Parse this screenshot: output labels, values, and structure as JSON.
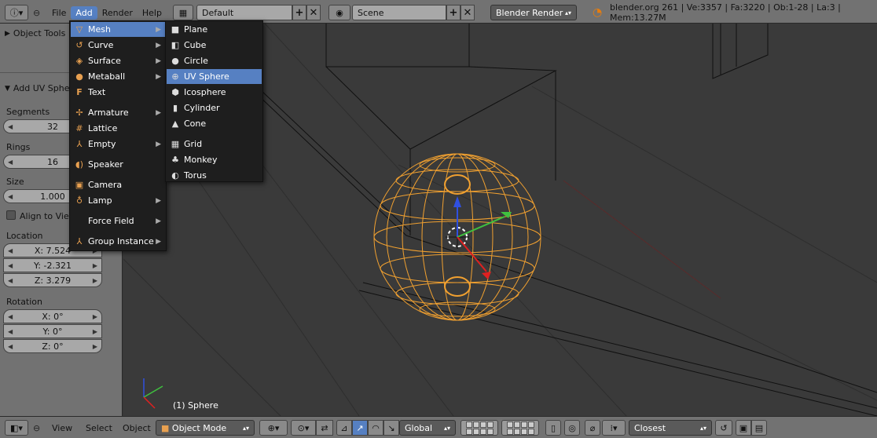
{
  "header": {
    "menus": [
      "File",
      "Add",
      "Render",
      "Help"
    ],
    "screen_layout": "Default",
    "scene": "Scene",
    "render_engine": "Blender Render",
    "stats": "blender.org 261 | Ve:3357 | Fa:3220 | Ob:1-28 | La:3 | Mem:13.27M"
  },
  "tool_panel": {
    "object_tools": "Object Tools",
    "operator_title": "Add UV Sphere",
    "segments_label": "Segments",
    "segments_value": "32",
    "rings_label": "Rings",
    "rings_value": "16",
    "size_label": "Size",
    "size_value": "1.000",
    "align_label": "Align to View",
    "location_label": "Location",
    "loc_x": "X: 7.524",
    "loc_y": "Y: -2.321",
    "loc_z": "Z: 3.279",
    "rotation_label": "Rotation",
    "rot_x": "X: 0°",
    "rot_y": "Y: 0°",
    "rot_z": "Z: 0°"
  },
  "add_menu": {
    "items": [
      "Mesh",
      "Curve",
      "Surface",
      "Metaball",
      "Text",
      "Armature",
      "Lattice",
      "Empty",
      "Speaker",
      "Camera",
      "Lamp",
      "Force Field",
      "Group Instance"
    ],
    "highlighted": "Mesh"
  },
  "mesh_submenu": {
    "items": [
      "Plane",
      "Cube",
      "Circle",
      "UV Sphere",
      "Icosphere",
      "Cylinder",
      "Cone",
      "Grid",
      "Monkey",
      "Torus"
    ],
    "highlighted": "UV Sphere"
  },
  "viewport": {
    "object_label": "(1) Sphere",
    "selection_color": "#f0a030"
  },
  "footer": {
    "menus": [
      "View",
      "Select",
      "Object"
    ],
    "mode": "Object Mode",
    "orientation": "Global",
    "snap": "Closest"
  }
}
